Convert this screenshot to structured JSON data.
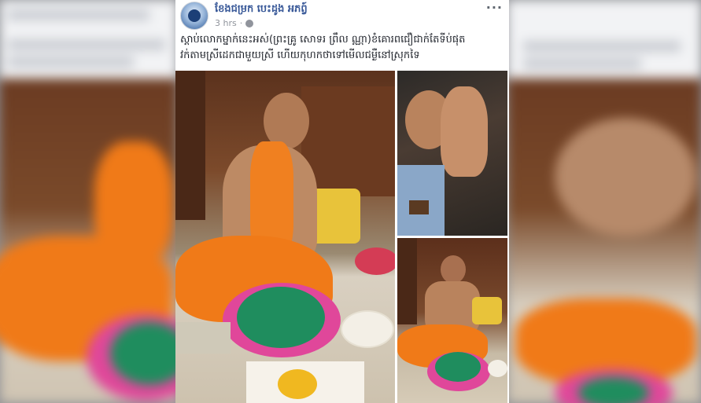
{
  "post": {
    "page_name": "ខែងជម្រក បេះដូង អភព្វ៍",
    "time": "3 hrs",
    "more_label": "···",
    "text_line1": "ស្តាប់លោកម្នាក់នេះអស់(ព្រះគ្រូ សោទរ ព្រឹល ណ្ណា)ខំគោរពជឿជាក់តែទីប់ផុត",
    "text_line2": "វក់តាមស្រីដេកជាមួយស្រី ហើយកុហកថាទៅមើលជម្ងឺនៅស្រុកទៃ"
  },
  "icons": {
    "avatar": "page-avatar-icon",
    "privacy": "globe-icon",
    "more": "more-options-icon"
  },
  "colors": {
    "page_name": "#385898",
    "meta": "#90949c",
    "robe": "#f07a18",
    "basin": "#1f8d5e",
    "plate": "#e0479a"
  }
}
